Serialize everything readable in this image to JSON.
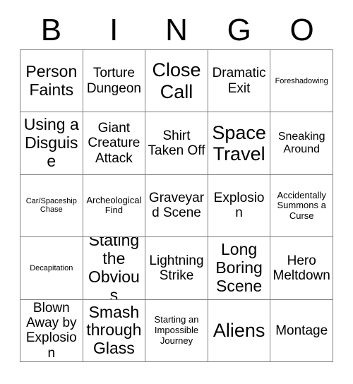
{
  "header": {
    "letters": [
      "B",
      "I",
      "N",
      "G",
      "O"
    ]
  },
  "grid": {
    "columns": 5,
    "rows": 5,
    "border_color": "#808080",
    "background_color": "#ffffff",
    "text_color": "#000000",
    "cells": [
      {
        "text": "Person Faints",
        "size": "fs-lg"
      },
      {
        "text": "Torture Dungeon",
        "size": "fs-md"
      },
      {
        "text": "Close Call",
        "size": "fs-xl"
      },
      {
        "text": "Dramatic Exit",
        "size": "fs-md"
      },
      {
        "text": "Foreshadowing",
        "size": "fs-xxs"
      },
      {
        "text": "Using a Disguise",
        "size": "fs-lg"
      },
      {
        "text": "Giant Creature Attack",
        "size": "fs-md"
      },
      {
        "text": "Shirt Taken Off",
        "size": "fs-md"
      },
      {
        "text": "Space Travel",
        "size": "fs-xl"
      },
      {
        "text": "Sneaking Around",
        "size": "fs-sm"
      },
      {
        "text": "Car/Spaceship Chase",
        "size": "fs-xxs"
      },
      {
        "text": "Archeological Find",
        "size": "fs-xs"
      },
      {
        "text": "Graveyard Scene",
        "size": "fs-md"
      },
      {
        "text": "Explosion",
        "size": "fs-md"
      },
      {
        "text": "Accidentally Summons a Curse",
        "size": "fs-xs"
      },
      {
        "text": "Decapitation",
        "size": "fs-xxs"
      },
      {
        "text": "Stating the Obvious",
        "size": "fs-lg"
      },
      {
        "text": "Lightning Strike",
        "size": "fs-md"
      },
      {
        "text": "Long Boring Scene",
        "size": "fs-lg"
      },
      {
        "text": "Hero Meltdown",
        "size": "fs-md"
      },
      {
        "text": "Blown Away by Explosion",
        "size": "fs-md"
      },
      {
        "text": "Smash through Glass",
        "size": "fs-lg"
      },
      {
        "text": "Starting an Impossible Journey",
        "size": "fs-xs"
      },
      {
        "text": "Aliens",
        "size": "fs-xl"
      },
      {
        "text": "Montage",
        "size": "fs-md"
      }
    ]
  }
}
